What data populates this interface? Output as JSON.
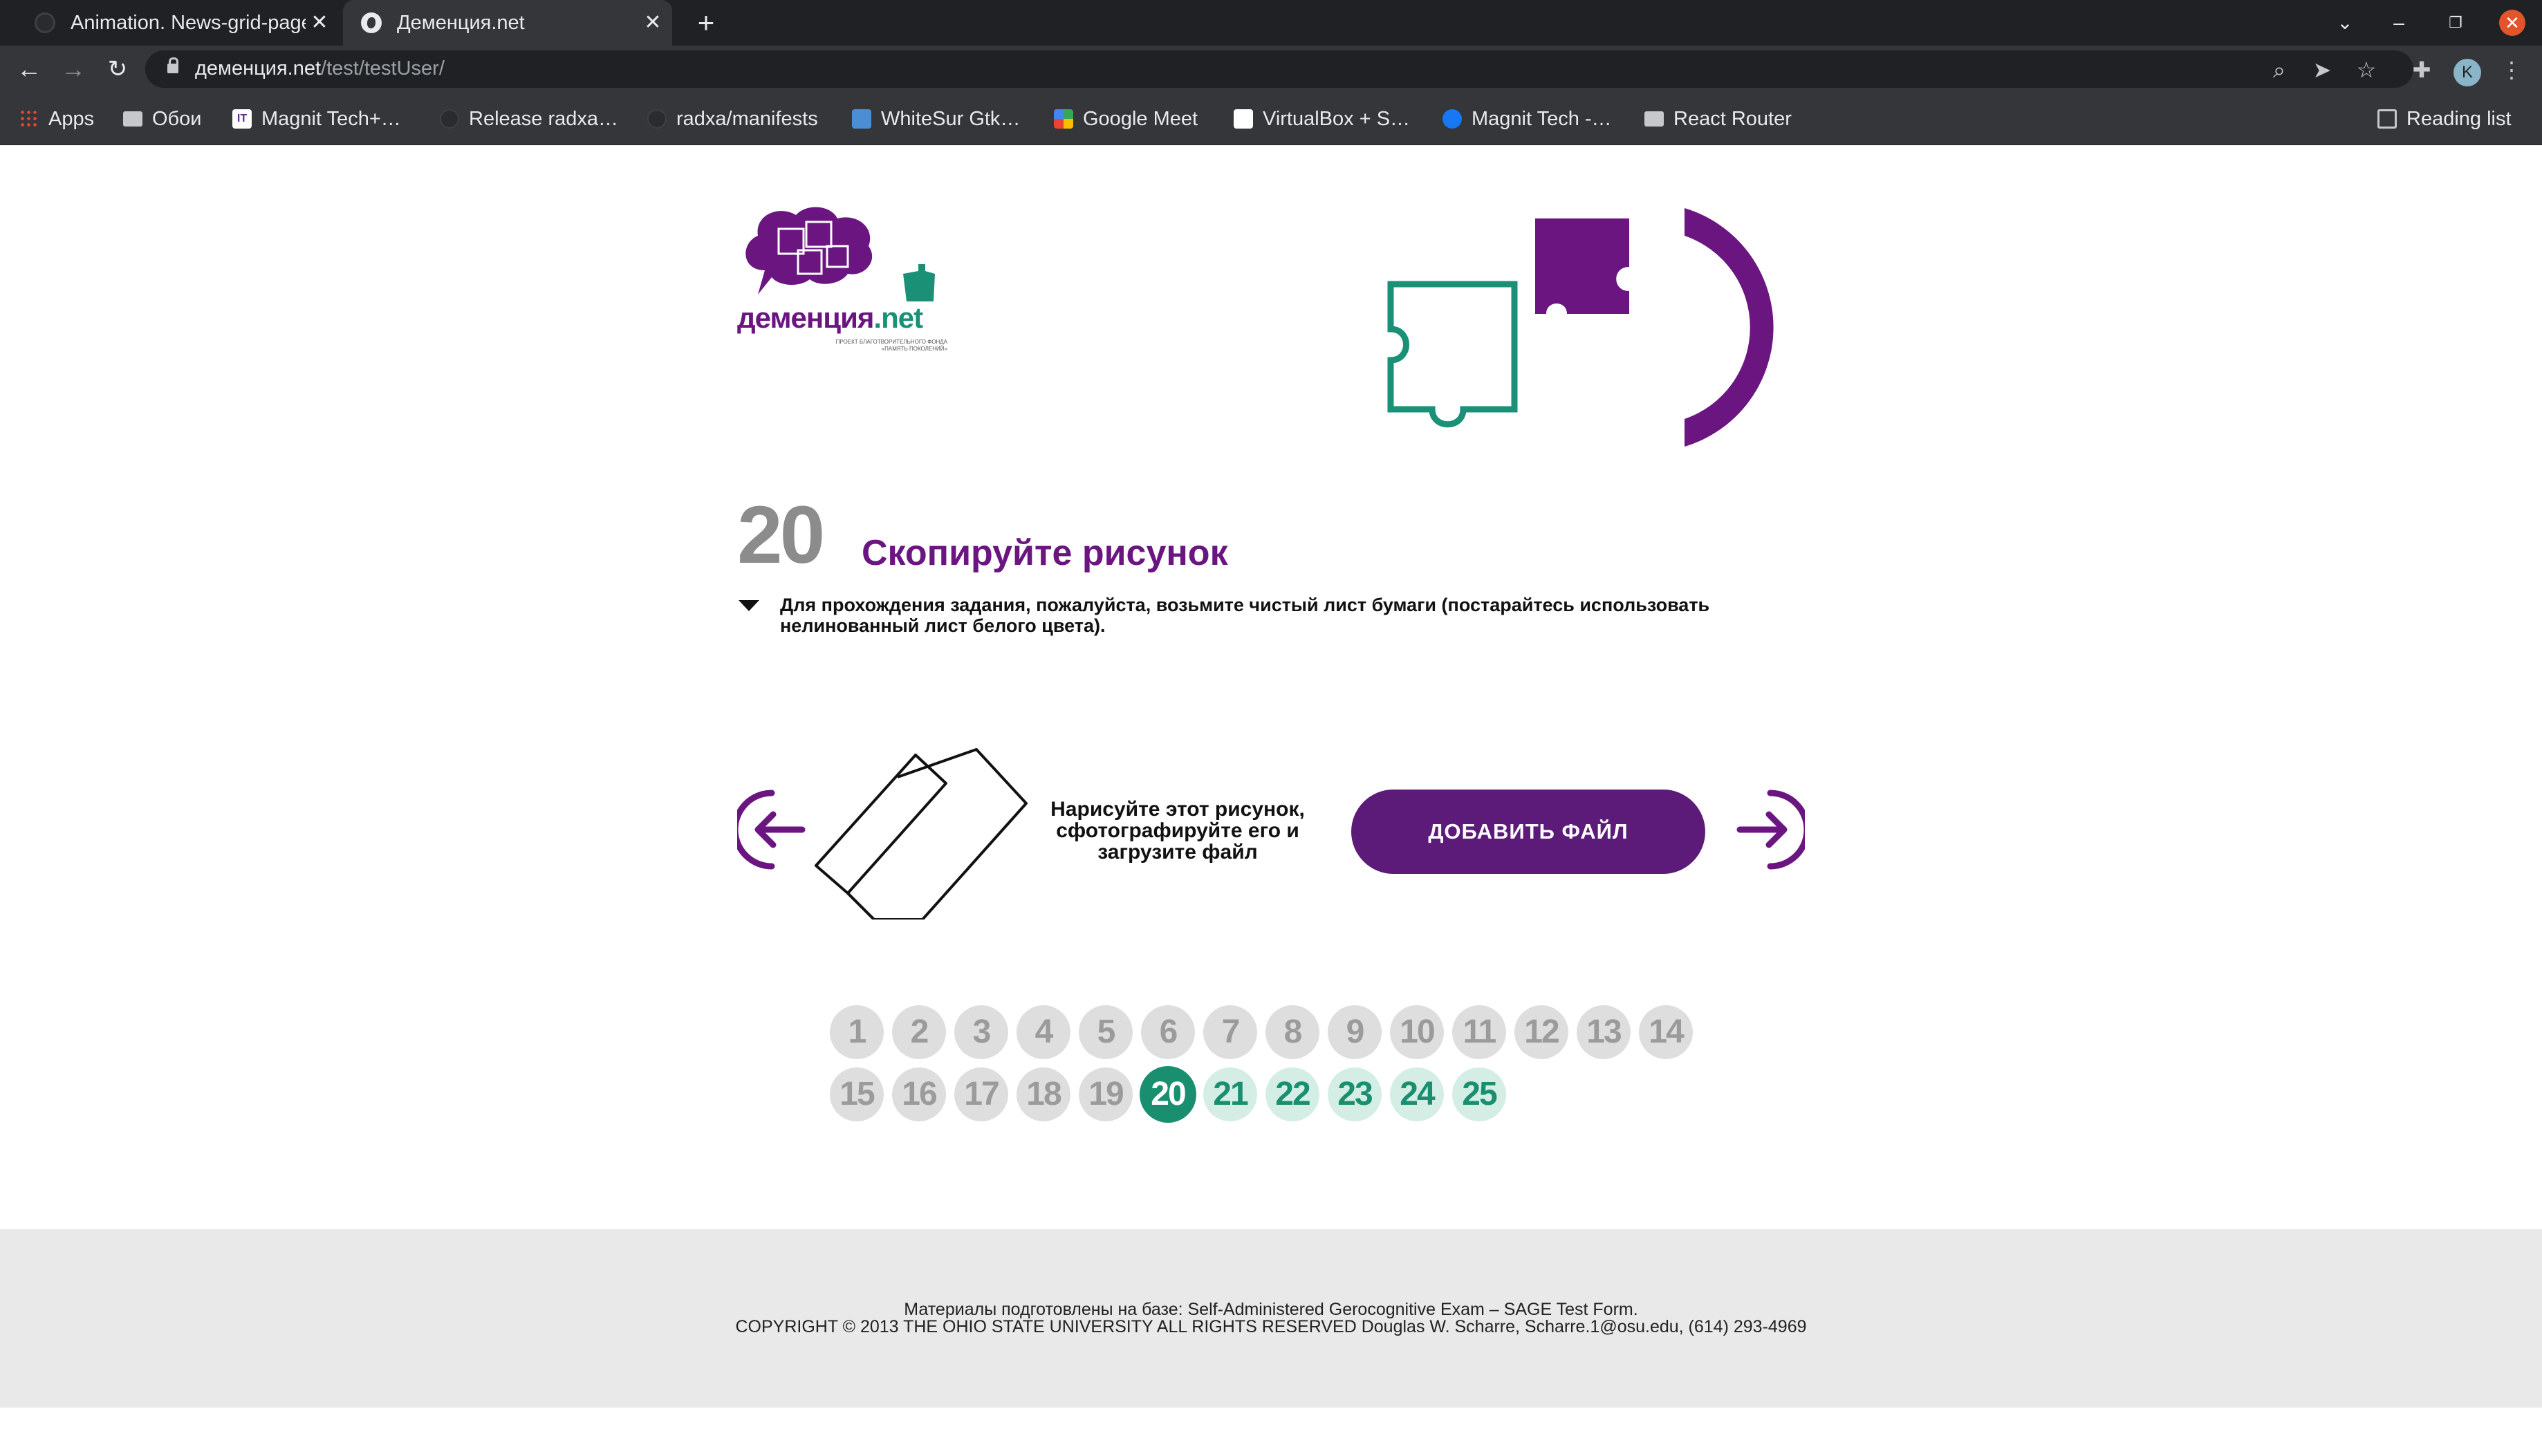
{
  "browser": {
    "tabs": [
      {
        "title": "Animation. News-grid-page",
        "active": false
      },
      {
        "title": "Деменция.net",
        "active": true
      }
    ],
    "url_host": "деменция.net",
    "url_path": "/test/testUser/",
    "profile_initial": "K",
    "bookmarks": [
      {
        "label": "Apps",
        "icon": "apps-grid-icon"
      },
      {
        "label": "Обои",
        "icon": "folder-icon"
      },
      {
        "label": "Magnit Tech+…",
        "icon": "it-logo-icon"
      },
      {
        "label": "Release radxa…",
        "icon": "github-icon"
      },
      {
        "label": "radxa/manifests",
        "icon": "github-icon"
      },
      {
        "label": "WhiteSur Gtk…",
        "icon": "whitesur-icon"
      },
      {
        "label": "Google Meet",
        "icon": "google-meet-icon"
      },
      {
        "label": "VirtualBox + S…",
        "icon": "notion-icon"
      },
      {
        "label": "Magnit Tech -…",
        "icon": "facebook-icon"
      },
      {
        "label": "React Router",
        "icon": "folder-icon"
      }
    ],
    "reading_list": "Reading list"
  },
  "site": {
    "logo_text_main": "деменция",
    "logo_text_net": ".net",
    "logo_subtitle": "ПРОЕКТ БЛАГОТВОРИТЕЛЬНОГО ФОНДА «ПАМЯТЬ ПОКОЛЕНИЙ»",
    "brand_purple": "#6b1680",
    "brand_green": "#1a9076"
  },
  "question": {
    "number": "20",
    "title": "Скопируйте рисунок",
    "description": "Для прохождения задания, пожалуйста, возьмите чистый лист бумаги (постарайтесь использовать нелинованный лист белого цвета).",
    "instruction": "Нарисуйте этот рисунок, сфотографируйте его и загрузите файл",
    "add_file_label": "ДОБАВИТЬ ФАЙЛ"
  },
  "pager": {
    "current": 20,
    "items": [
      {
        "label": "1",
        "state": "done"
      },
      {
        "label": "2",
        "state": "done"
      },
      {
        "label": "3",
        "state": "done"
      },
      {
        "label": "4",
        "state": "done"
      },
      {
        "label": "5",
        "state": "done"
      },
      {
        "label": "6",
        "state": "done"
      },
      {
        "label": "7",
        "state": "done"
      },
      {
        "label": "8",
        "state": "done"
      },
      {
        "label": "9",
        "state": "done"
      },
      {
        "label": "10",
        "state": "done"
      },
      {
        "label": "11",
        "state": "done"
      },
      {
        "label": "12",
        "state": "done"
      },
      {
        "label": "13",
        "state": "done"
      },
      {
        "label": "14",
        "state": "done"
      },
      {
        "label": "15",
        "state": "done"
      },
      {
        "label": "16",
        "state": "done"
      },
      {
        "label": "17",
        "state": "done"
      },
      {
        "label": "18",
        "state": "done"
      },
      {
        "label": "19",
        "state": "done"
      },
      {
        "label": "20",
        "state": "current"
      },
      {
        "label": "21",
        "state": "upcoming"
      },
      {
        "label": "22",
        "state": "upcoming"
      },
      {
        "label": "23",
        "state": "upcoming"
      },
      {
        "label": "24",
        "state": "upcoming"
      },
      {
        "label": "25",
        "state": "upcoming"
      }
    ]
  },
  "footer": {
    "line1": "Материалы подготовлены на базе: Self-Administered Gerocognitive Exam – SAGE Test Form.",
    "line2": "COPYRIGHT © 2013 THE OHIO STATE UNIVERSITY ALL RIGHTS RESERVED Douglas W. Scharre, Scharre.1@osu.edu, (614) 293-4969"
  }
}
